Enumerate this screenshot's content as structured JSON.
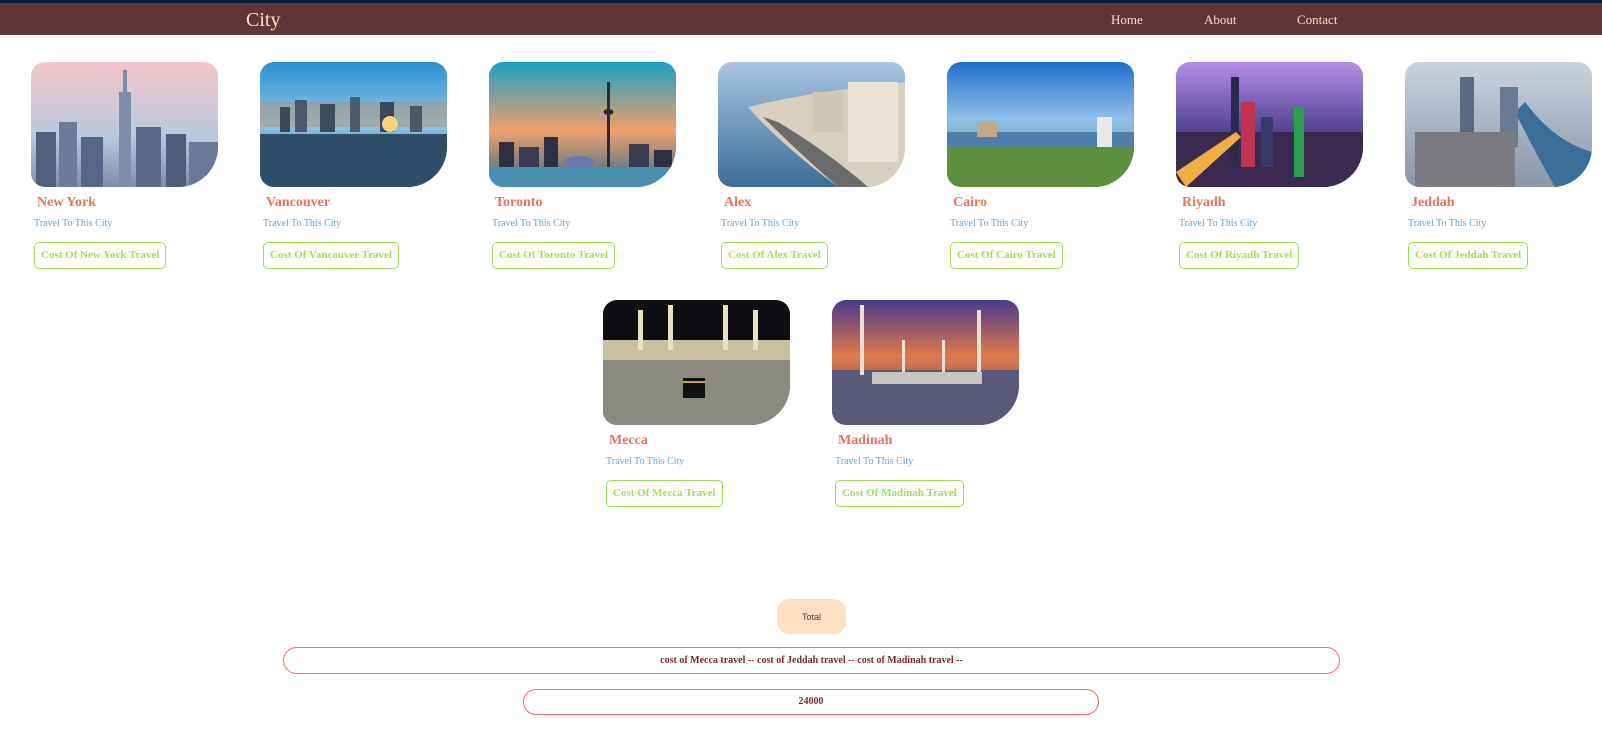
{
  "header": {
    "brand": "City",
    "nav": [
      "Home",
      "About",
      "Contact"
    ]
  },
  "cities": [
    {
      "name": "New York",
      "tagline": "Travel To This City",
      "button": "Cost Of New York Travel",
      "palette": "nyc"
    },
    {
      "name": "Vancouver",
      "tagline": "Travel To This City",
      "button": "Cost Of Vancouver Travel",
      "palette": "vancouver"
    },
    {
      "name": "Toronto",
      "tagline": "Travel To This City",
      "button": "Cost Of Toronto Travel",
      "palette": "toronto"
    },
    {
      "name": "Alex",
      "tagline": "Travel To This City",
      "button": "Cost Of Alex Travel",
      "palette": "alex"
    },
    {
      "name": "Cairo",
      "tagline": "Travel To This City",
      "button": "Cost Of Cairo Travel",
      "palette": "cairo"
    },
    {
      "name": "Riyadh",
      "tagline": "Travel To This City",
      "button": "Cost Of Riyadh Travel",
      "palette": "riyadh"
    },
    {
      "name": "Jeddah",
      "tagline": "Travel To This City",
      "button": "Cost Of Jeddah Travel",
      "palette": "jeddah"
    },
    {
      "name": "Mecca",
      "tagline": "Travel To This City",
      "button": "Cost Of Mecca Travel",
      "palette": "mecca"
    },
    {
      "name": "Madinah",
      "tagline": "Travel To This City",
      "button": "Cost Of Madinah Travel",
      "palette": "madinah"
    }
  ],
  "footer": {
    "total_label": "Total",
    "selection_text": "cost of Mecca travel -- cost of Jeddah travel -- cost of Madinah travel --",
    "total_value": "24000"
  },
  "colors": {
    "navbar": "#5e3639",
    "brand": "#fde3c0",
    "city_name": "#e9735d",
    "tagline": "#63a7d6",
    "button_border": "#9ae04a",
    "total_button": "#fde0bf",
    "field_border": "#ee6a62"
  }
}
